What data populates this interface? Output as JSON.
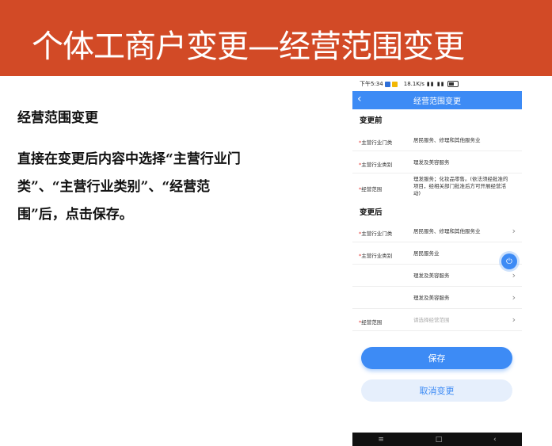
{
  "slide": {
    "title": "个体工商户变更—经营范围变更",
    "heading": "经营范围变更",
    "body": "直接在变更后内容中选择“主营行业门类”、“主营行业类别”、“经营范围”后，点击保存。"
  },
  "phone": {
    "status": {
      "time": "下午5:34",
      "speed": "18.1K/s"
    },
    "appbar": {
      "back": "‹",
      "title": "经营范围变更"
    },
    "before": {
      "title": "变更前",
      "rows": [
        {
          "label": "主营行业门类",
          "value": "居民服务、修理和其他服务业"
        },
        {
          "label": "主营行业类别",
          "value": "理发及美容服务"
        },
        {
          "label": "经营范围",
          "value": "理发服务；化妆品零售。(依法须经批准的项目，经相关部门批准后方可开展经营活动)"
        }
      ]
    },
    "after": {
      "title": "变更后",
      "rows": [
        {
          "label": "主营行业门类",
          "value": "居民服务、修理和其他服务业"
        },
        {
          "label": "主营行业类别",
          "value": "居民服务业"
        },
        {
          "label": "",
          "value": "理发及美容服务"
        },
        {
          "label": "",
          "value": "理发及美容服务"
        },
        {
          "label": "经营范围",
          "placeholder": "请选择经营范围"
        }
      ]
    },
    "buttons": {
      "save": "保存",
      "cancel": "取消变更"
    },
    "navbar": {
      "menu": "≡",
      "home": "□",
      "back": "‹"
    }
  },
  "colors": {
    "banner": "#d24a26",
    "accent": "#3d8bf5",
    "required": "#e53935"
  }
}
